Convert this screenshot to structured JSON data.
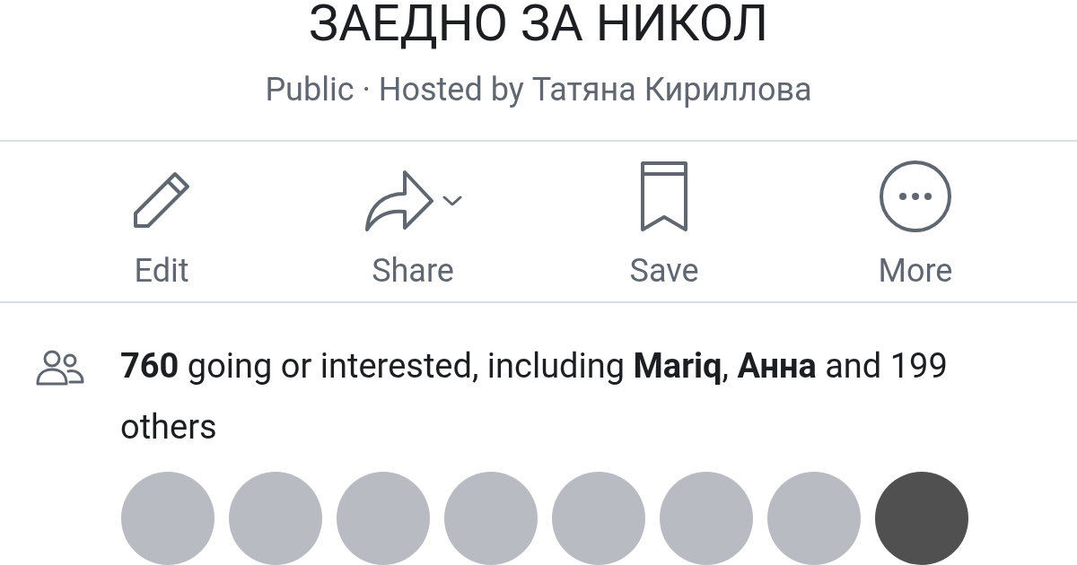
{
  "event": {
    "title": "ЗАЕДНО ЗА НИКОЛ",
    "subtitle": "Public · Hosted by Татяна Кириллова"
  },
  "actions": [
    {
      "kind": "edit",
      "label": "Edit"
    },
    {
      "kind": "share",
      "label": "Share"
    },
    {
      "kind": "save",
      "label": "Save"
    },
    {
      "kind": "more",
      "label": "More"
    }
  ],
  "attendance": {
    "text": "**760** going or interested, including **Mariq**, **Анна** and 199 others"
  },
  "avatars": [
    {
      "kind": "photo"
    },
    {
      "kind": "photo"
    },
    {
      "kind": "photo"
    },
    {
      "kind": "photo"
    },
    {
      "kind": "photo"
    },
    {
      "kind": "photo"
    },
    {
      "kind": "photo"
    },
    {
      "kind": "more"
    }
  ]
}
